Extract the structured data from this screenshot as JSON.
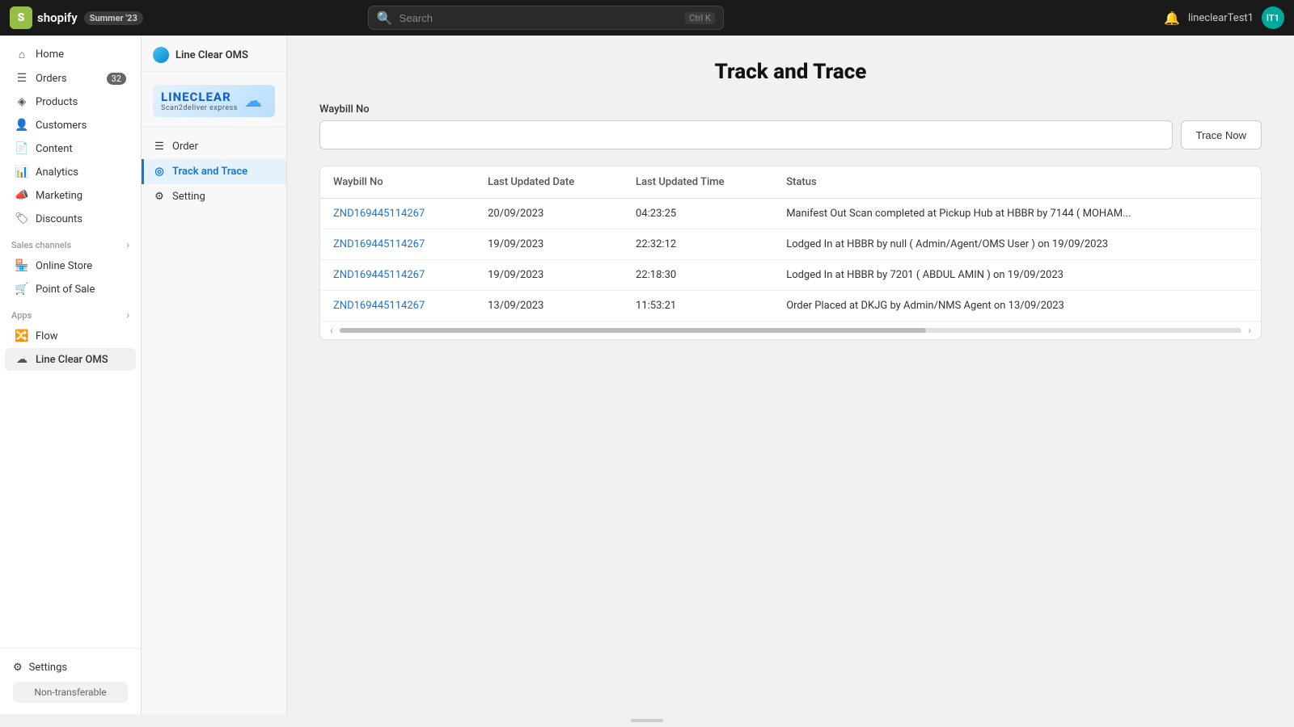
{
  "topbar": {
    "logo_letter": "S",
    "logo_name": "shopify",
    "badge": "Summer '23",
    "search_placeholder": "Search",
    "shortcut": "Ctrl K",
    "bell_icon": "🔔",
    "user_initials": "lT1",
    "user_label": "lineclearTest1"
  },
  "sidebar": {
    "items": [
      {
        "id": "home",
        "label": "Home",
        "icon": "⌂"
      },
      {
        "id": "orders",
        "label": "Orders",
        "icon": "☰",
        "badge": "32"
      },
      {
        "id": "products",
        "label": "Products",
        "icon": "◈"
      },
      {
        "id": "customers",
        "label": "Customers",
        "icon": "👤"
      },
      {
        "id": "content",
        "label": "Content",
        "icon": "📄"
      },
      {
        "id": "analytics",
        "label": "Analytics",
        "icon": "📊"
      },
      {
        "id": "marketing",
        "label": "Marketing",
        "icon": "📣"
      },
      {
        "id": "discounts",
        "label": "Discounts",
        "icon": "🏷"
      }
    ],
    "sales_channels_label": "Sales channels",
    "sales_channels": [
      {
        "id": "online-store",
        "label": "Online Store",
        "icon": "🏪"
      },
      {
        "id": "point-of-sale",
        "label": "Point of Sale",
        "icon": "🛒"
      }
    ],
    "apps_label": "Apps",
    "apps": [
      {
        "id": "flow",
        "label": "Flow",
        "icon": "🔀"
      },
      {
        "id": "line-clear-oms",
        "label": "Line Clear OMS",
        "icon": "☁"
      }
    ],
    "settings_label": "Settings",
    "non_transferable": "Non-transferable"
  },
  "plugin_sidebar": {
    "header_title": "Line Clear OMS",
    "logo_main": "LINECLEAR",
    "logo_sub": "Scan2deliver express",
    "nav_items": [
      {
        "id": "order",
        "label": "Order",
        "icon": "☰"
      },
      {
        "id": "track-and-trace",
        "label": "Track and Trace",
        "icon": "◎",
        "active": true
      },
      {
        "id": "setting",
        "label": "Setting",
        "icon": "⚙"
      }
    ]
  },
  "main": {
    "page_title": "Track and Trace",
    "waybill_label": "Waybill No",
    "waybill_placeholder": "",
    "trace_button": "Trace Now",
    "table": {
      "columns": [
        "Waybill No",
        "Last Updated Date",
        "Last Updated Time",
        "Status"
      ],
      "rows": [
        {
          "waybill": "ZND169445114267",
          "date": "20/09/2023",
          "time": "04:23:25",
          "status": "Manifest Out Scan completed at Pickup Hub at HBBR by 7144 ( MOHAM..."
        },
        {
          "waybill": "ZND169445114267",
          "date": "19/09/2023",
          "time": "22:32:12",
          "status": "Lodged In at HBBR by null ( Admin/Agent/OMS User ) on 19/09/2023"
        },
        {
          "waybill": "ZND169445114267",
          "date": "19/09/2023",
          "time": "22:18:30",
          "status": "Lodged In at HBBR by 7201 ( ABDUL AMIN ) on 19/09/2023"
        },
        {
          "waybill": "ZND169445114267",
          "date": "13/09/2023",
          "time": "11:53:21",
          "status": "Order Placed at DKJG by Admin/NMS Agent on 13/09/2023"
        }
      ]
    }
  }
}
